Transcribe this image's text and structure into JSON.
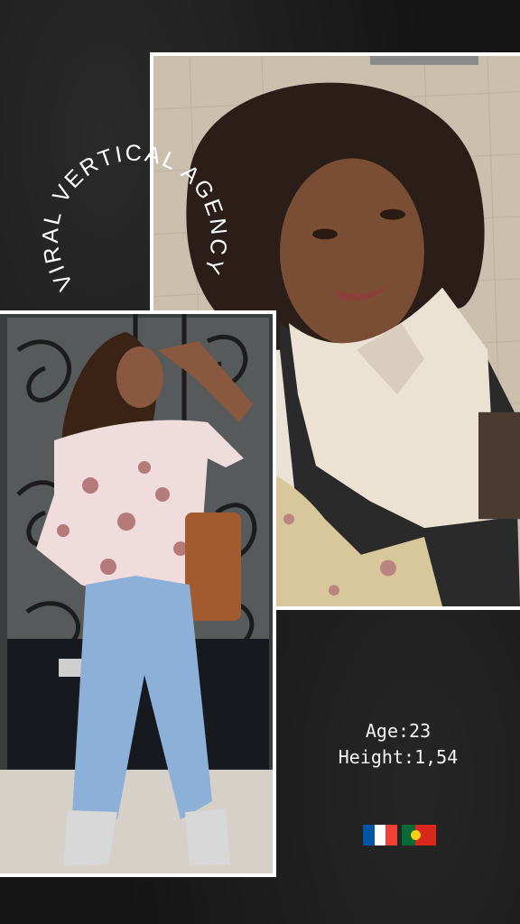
{
  "brand": {
    "curved_text": "VIRAL VERTICAL AGENCY"
  },
  "profile": {
    "age_label": "Age:",
    "age_value": "23",
    "height_label": "Height:",
    "height_value": "1,54"
  },
  "flags": [
    "france-flag",
    "portugal-flag"
  ],
  "colors": {
    "background": "#151515",
    "text": "#f4f4f4",
    "frame": "#ffffff",
    "france_blue": "#0055a4",
    "france_red": "#ef4135",
    "portugal_green": "#046a38",
    "portugal_red": "#da291c"
  }
}
